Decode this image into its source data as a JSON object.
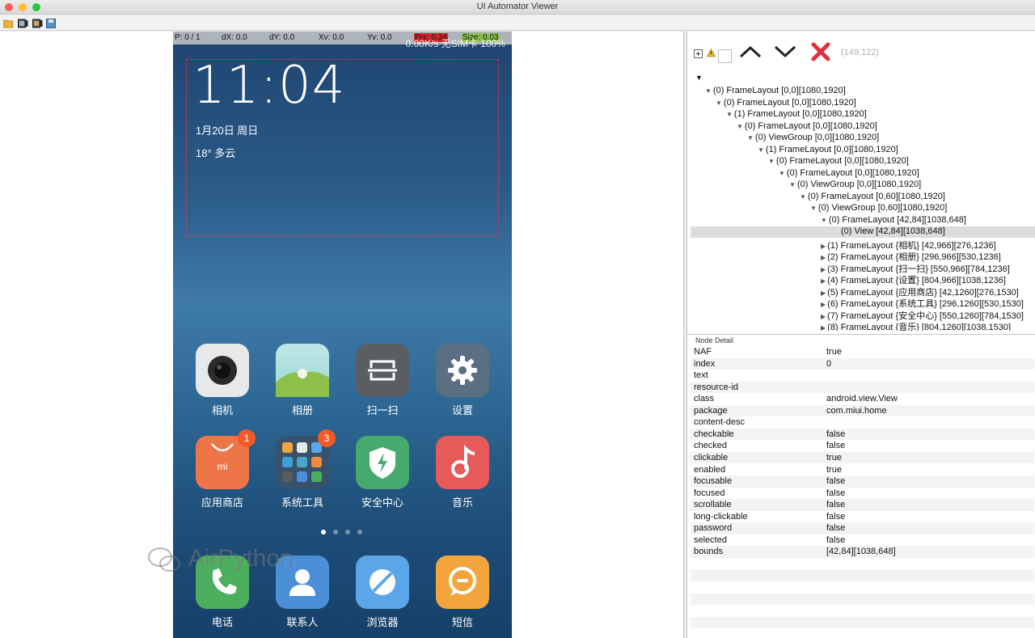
{
  "window": {
    "title": "UI Automator Viewer"
  },
  "toolbar": {
    "buttons": [
      "open-folder-icon",
      "device-screenshot-icon",
      "device-screenshot-compressed-icon",
      "save-icon"
    ]
  },
  "statusbar": {
    "p": "P: 0 / 1",
    "dx": "dX: 0.0",
    "dy": "dY: 0.0",
    "xv": "Xv: 0.0",
    "yv": "Yv: 0.0",
    "prs": "Prs: 0.34",
    "size": "Size: 0.03",
    "phone_status": "0.00K/s   无SIM卡   100%"
  },
  "lockscreen": {
    "time": "11:04",
    "date": "1月20日 周日",
    "weather": "18° 多云"
  },
  "apps": [
    {
      "label": "相机",
      "icon": "camera-icon",
      "color": "#e6e8ea"
    },
    {
      "label": "相册",
      "icon": "gallery-icon",
      "color": "#9bd6d3"
    },
    {
      "label": "扫一扫",
      "icon": "scan-icon",
      "color": "#5a5e63"
    },
    {
      "label": "设置",
      "icon": "settings-gear-icon",
      "color": "#5a6f82"
    },
    {
      "label": "应用商店",
      "icon": "app-store-icon",
      "color": "#ed7548",
      "badge": "1"
    },
    {
      "label": "系统工具",
      "icon": "system-tools-folder-icon",
      "color": "#39526b",
      "badge": "3"
    },
    {
      "label": "安全中心",
      "icon": "security-shield-icon",
      "color": "#46a96d"
    },
    {
      "label": "音乐",
      "icon": "music-note-icon",
      "color": "#e65a5a"
    }
  ],
  "dock": [
    {
      "label": "电话",
      "icon": "phone-icon",
      "color": "#4caf5e"
    },
    {
      "label": "联系人",
      "icon": "contacts-icon",
      "color": "#4a8fd8"
    },
    {
      "label": "浏览器",
      "icon": "browser-icon",
      "color": "#5ba6e8"
    },
    {
      "label": "短信",
      "icon": "sms-icon",
      "color": "#f2a53d"
    }
  ],
  "tree_toolbar": {
    "coords": "(149,122)"
  },
  "tree": [
    {
      "text": "(0) FrameLayout [0,0][1080,1920]",
      "depth": 1
    },
    {
      "text": "(0) FrameLayout [0,0][1080,1920]",
      "depth": 2
    },
    {
      "text": "(1) FrameLayout [0,0][1080,1920]",
      "depth": 3
    },
    {
      "text": "(0) FrameLayout [0,0][1080,1920]",
      "depth": 4
    },
    {
      "text": "(0) ViewGroup [0,0][1080,1920]",
      "depth": 5
    },
    {
      "text": "(1) FrameLayout [0,0][1080,1920]",
      "depth": 6
    },
    {
      "text": "(0) FrameLayout [0,0][1080,1920]",
      "depth": 7
    },
    {
      "text": "(0) FrameLayout [0,0][1080,1920]",
      "depth": 8
    },
    {
      "text": "(0) ViewGroup [0,0][1080,1920]",
      "depth": 9
    },
    {
      "text": "(0) FrameLayout [0,60][1080,1920]",
      "depth": 10
    },
    {
      "text": "(0) ViewGroup [0,60][1080,1920]",
      "depth": 11
    },
    {
      "text": "(0) FrameLayout [42,84][1038,648]",
      "depth": 12
    },
    {
      "text": "(0) View [42,84][1038,648]",
      "depth": 13,
      "selected": true
    },
    {
      "text": "(1) FrameLayout {相机} [42,966][276,1236]",
      "depth": 12,
      "collapsed": true
    },
    {
      "text": "(2) FrameLayout {相册} [296,966][530,1236]",
      "depth": 12,
      "collapsed": true
    },
    {
      "text": "(3) FrameLayout {扫一扫} [550,966][784,1236]",
      "depth": 12,
      "collapsed": true
    },
    {
      "text": "(4) FrameLayout {设置} [804,966][1038,1236]",
      "depth": 12,
      "collapsed": true
    },
    {
      "text": "(5) FrameLayout {应用商店} [42,1260][276,1530]",
      "depth": 12,
      "collapsed": true
    },
    {
      "text": "(6) FrameLayout {系统工具} [296,1260][530,1530]",
      "depth": 12,
      "collapsed": true
    },
    {
      "text": "(7) FrameLayout {安全中心} [550,1260][784,1530]",
      "depth": 12,
      "collapsed": true
    },
    {
      "text": "(8) FrameLayout {音乐} [804,1260][1038,1530]",
      "depth": 12,
      "collapsed": true
    }
  ],
  "detail": {
    "title": "Node Detail",
    "rows": [
      {
        "name": "NAF",
        "value": "true"
      },
      {
        "name": "index",
        "value": "0"
      },
      {
        "name": "text",
        "value": ""
      },
      {
        "name": "resource-id",
        "value": ""
      },
      {
        "name": "class",
        "value": "android.view.View"
      },
      {
        "name": "package",
        "value": "com.miui.home"
      },
      {
        "name": "content-desc",
        "value": ""
      },
      {
        "name": "checkable",
        "value": "false"
      },
      {
        "name": "checked",
        "value": "false"
      },
      {
        "name": "clickable",
        "value": "true"
      },
      {
        "name": "enabled",
        "value": "true"
      },
      {
        "name": "focusable",
        "value": "false"
      },
      {
        "name": "focused",
        "value": "false"
      },
      {
        "name": "scrollable",
        "value": "false"
      },
      {
        "name": "long-clickable",
        "value": "false"
      },
      {
        "name": "password",
        "value": "false"
      },
      {
        "name": "selected",
        "value": "false"
      },
      {
        "name": "bounds",
        "value": "[42,84][1038,648]"
      }
    ]
  },
  "watermark": "AirPython",
  "colors": {
    "selection_rect": "#e0393e",
    "close": "#e0303e",
    "badge": "#f25a27"
  }
}
